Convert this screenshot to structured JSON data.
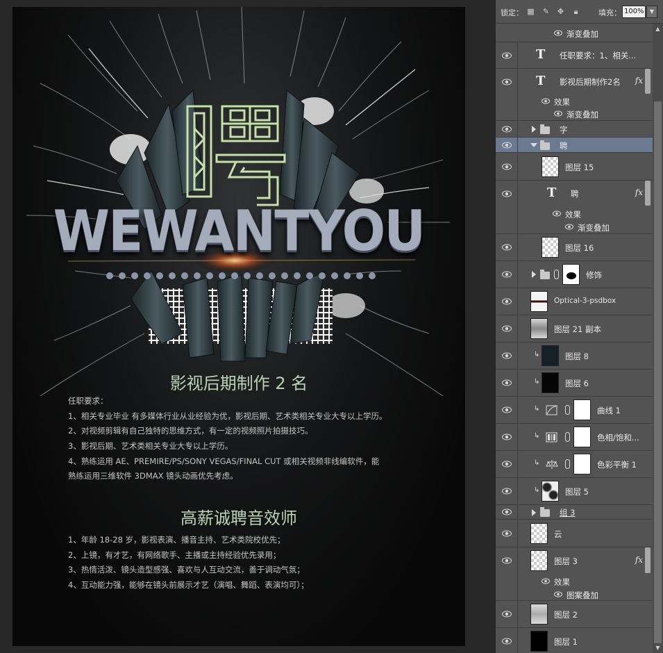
{
  "poster": {
    "big_char": "聘",
    "headline": "WEWANTYOU",
    "job1": {
      "title": "影视后期制作 2 名",
      "lines": [
        "任职要求：",
        "1、相关专业毕业 有多媒体行业从业经验为优，影视后期、艺术类相关专业大专以上学历。",
        "2、对视频剪辑有自己独特的思维方式，有一定的视频照片拍摄技巧。",
        "3、影视后期、艺术类相关专业大专以上学历。",
        "4、熟练运用 AE、PREMIRE/PS/SONY VEGAS/FINAL CUT 或相关视频非线编软件，能",
        "熟练运用三维软件 3DMAX 镜头动画优先考虑。"
      ]
    },
    "job2": {
      "title": "高薪诚聘音效师",
      "lines": [
        "1、年龄 18-28 岁，影视表演、播音主持、艺术类院校优先；",
        "2、上镜，有才艺，有网络歌手、主播或主持经验优先录用；",
        "3、热情活泼、镜头造型感强、喜欢与人互动交流，善于调动气氛；",
        "4、互动能力强，能够在镜头前展示才艺（演唱、舞蹈、表演均可）；"
      ]
    }
  },
  "panel": {
    "lock_label": "锁定：",
    "fill_label": "填充：",
    "fill_value": "100%",
    "layers": {
      "r0_effect": "渐变叠加",
      "r1": "任职要求：1、相关...",
      "r2": "影视后期制作2名",
      "r2_effects": "效果",
      "r2_effect1": "渐变叠加",
      "r3": "字",
      "r4": "聘",
      "r5": "图层 15",
      "r6": "聘",
      "r6_effects": "效果",
      "r6_effect1": "渐变叠加",
      "r7": "图层 16",
      "r8": "修饰",
      "r9": "Optical-3-psdbox",
      "r10": "图层 21 副本",
      "r11": "图层 8",
      "r12": "图层 6",
      "r13": "曲线 1",
      "r14": "色相/饱和...",
      "r15": "色彩平衡 1",
      "r16": "图层 5",
      "r17": "组 3",
      "r18": "云",
      "r19": "图层 3",
      "r19_effects": "效果",
      "r19_effect1": "图案叠加",
      "r20": "图层 2",
      "r21": "图层 1"
    },
    "fx": "fx"
  }
}
